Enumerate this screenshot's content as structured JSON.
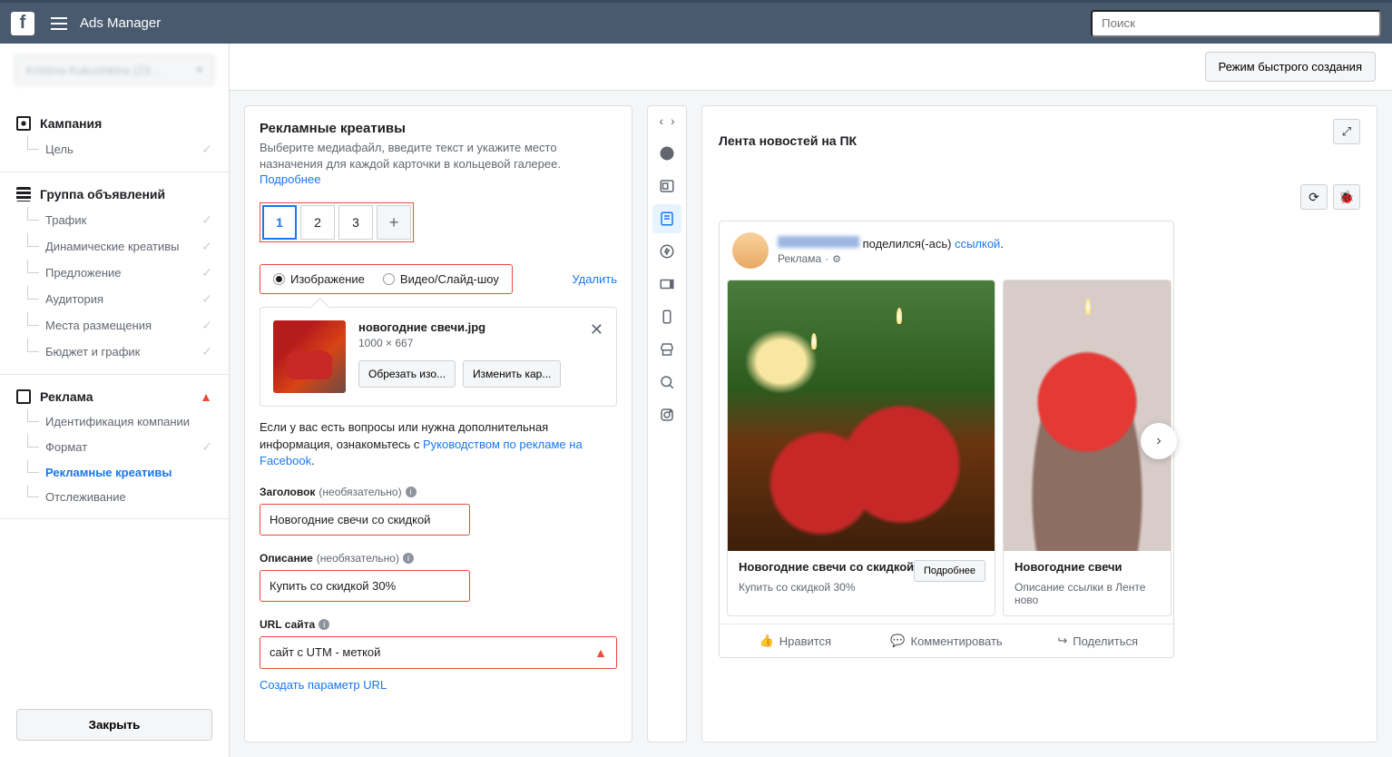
{
  "header": {
    "title": "Ads Manager",
    "search_placeholder": "Поиск"
  },
  "account_selector": "Kristina Kukushkina (23...",
  "toolbar": {
    "quick_mode": "Режим быстрого создания"
  },
  "nav": {
    "campaign": {
      "title": "Кампания",
      "items": [
        {
          "label": "Цель",
          "check": true
        }
      ]
    },
    "adset": {
      "title": "Группа объявлений",
      "items": [
        {
          "label": "Трафик",
          "check": true
        },
        {
          "label": "Динамические креативы",
          "check": true
        },
        {
          "label": "Предложение",
          "check": true
        },
        {
          "label": "Аудитория",
          "check": true
        },
        {
          "label": "Места размещения",
          "check": true
        },
        {
          "label": "Бюджет и график",
          "check": true
        }
      ]
    },
    "ad": {
      "title": "Реклама",
      "warn": true,
      "items": [
        {
          "label": "Идентификация компании"
        },
        {
          "label": "Формат",
          "check": true
        },
        {
          "label": "Рекламные креативы",
          "active": true
        },
        {
          "label": "Отслеживание"
        }
      ]
    }
  },
  "footer": {
    "close": "Закрыть"
  },
  "editor": {
    "title": "Рекламные креативы",
    "subtitle": "Выберите медиафайл, введите текст и укажите место назначения для каждой карточки в кольцевой галерее.",
    "more": "Подробнее",
    "cards": [
      "1",
      "2",
      "3"
    ],
    "delete": "Удалить",
    "media_types": {
      "image": "Изображение",
      "video": "Видео/Слайд-шоу"
    },
    "file": {
      "name": "новогодние свечи.jpg",
      "dim": "1000 × 667",
      "crop": "Обрезать изо...",
      "change": "Изменить кар..."
    },
    "help_text_pre": "Если у вас есть вопросы или нужна дополнительная информация, ознакомьтесь с ",
    "help_link": "Руководством по рекламе на Facebook",
    "help_text_post": ".",
    "fields": {
      "headline_label": "Заголовок",
      "optional": "(необязательно)",
      "headline_value": "Новогодние свечи со скидкой",
      "description_label": "Описание",
      "description_value": "Купить со скидкой 30%",
      "url_label": "URL сайта",
      "url_value": "сайт с UTM - меткой",
      "create_url": "Создать параметр URL"
    }
  },
  "preview": {
    "title": "Лента новостей на ПК",
    "post": {
      "shared": " поделился(-ась) ",
      "link_word": "ссылкой",
      "ad_label": "Реклама",
      "cards": [
        {
          "title": "Новогодние свечи со скидкой",
          "subtitle": "Купить со скидкой 30%",
          "cta": "Подробнее"
        },
        {
          "title": "Новогодние свечи",
          "subtitle": "Описание ссылки в Ленте ново"
        }
      ],
      "actions": {
        "like": "Нравится",
        "comment": "Комментировать",
        "share": "Поделиться"
      }
    }
  }
}
